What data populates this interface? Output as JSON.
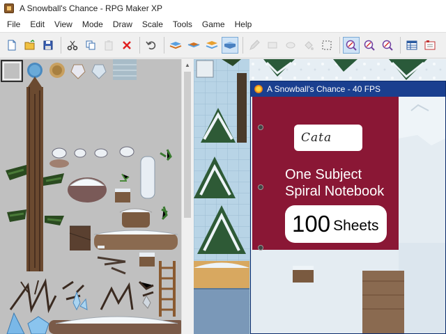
{
  "window": {
    "title": "A Snowball's Chance - RPG Maker XP",
    "app_icon": "rpg-maker-icon"
  },
  "menu": {
    "items": [
      "File",
      "Edit",
      "View",
      "Mode",
      "Draw",
      "Scale",
      "Tools",
      "Game",
      "Help"
    ]
  },
  "toolbar": {
    "buttons": [
      {
        "icon": "new-project-icon"
      },
      {
        "icon": "open-project-icon"
      },
      {
        "icon": "save-icon"
      },
      {
        "icon": "cut-icon"
      },
      {
        "icon": "copy-icon"
      },
      {
        "icon": "paste-icon"
      },
      {
        "icon": "delete-icon"
      },
      {
        "icon": "undo-icon"
      },
      {
        "icon": "layer-1-icon"
      },
      {
        "icon": "layer-2-icon"
      },
      {
        "icon": "layer-3-icon"
      },
      {
        "icon": "events-layer-icon"
      },
      {
        "icon": "pencil-icon"
      },
      {
        "icon": "rectangle-icon"
      },
      {
        "icon": "ellipse-icon"
      },
      {
        "icon": "flood-fill-icon"
      },
      {
        "icon": "select-icon"
      },
      {
        "icon": "zoom-1-1-icon"
      },
      {
        "icon": "zoom-1-2-icon"
      },
      {
        "icon": "zoom-1-4-icon"
      },
      {
        "icon": "database-icon"
      },
      {
        "icon": "materialbase-icon"
      }
    ]
  },
  "game_window": {
    "title": "A Snowball's Chance - 40 FPS",
    "notebook": {
      "name": "Cata",
      "subject_line1": "One Subject",
      "subject_line2": "Spiral Notebook",
      "sheets_count": "100",
      "sheets_label": "Sheets"
    }
  },
  "colors": {
    "notebook_cover": "#8a1735",
    "game_titlebar": "#1a3f8f",
    "tileset_bg": "#c0c0c0"
  }
}
